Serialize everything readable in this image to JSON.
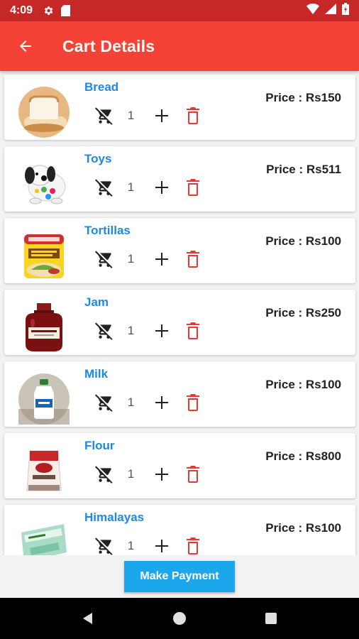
{
  "status_bar": {
    "time": "4:09"
  },
  "app_bar": {
    "title": "Cart Details"
  },
  "items": [
    {
      "name": "Bread",
      "qty": "1",
      "price": "Price : Rs150"
    },
    {
      "name": "Toys",
      "qty": "1",
      "price": "Price : Rs511"
    },
    {
      "name": "Tortillas",
      "qty": "1",
      "price": "Price : Rs100"
    },
    {
      "name": "Jam",
      "qty": "1",
      "price": "Price : Rs250"
    },
    {
      "name": "Milk",
      "qty": "1",
      "price": "Price : Rs100"
    },
    {
      "name": "Flour",
      "qty": "1",
      "price": "Price : Rs800"
    },
    {
      "name": "Himalayas",
      "qty": "1",
      "price": "Price : Rs100"
    }
  ],
  "footer": {
    "pay_label": "Make Payment"
  },
  "colors": {
    "app_bar": "#f44336",
    "status_bar": "#c62828",
    "item_name": "#1e88e5",
    "delete_icon": "#e53935",
    "pay_button": "#1ca7ec"
  },
  "icons": {
    "back": "arrow-back-icon",
    "remove_cart": "remove-shopping-cart-icon",
    "add": "plus-icon",
    "delete": "trash-icon"
  }
}
